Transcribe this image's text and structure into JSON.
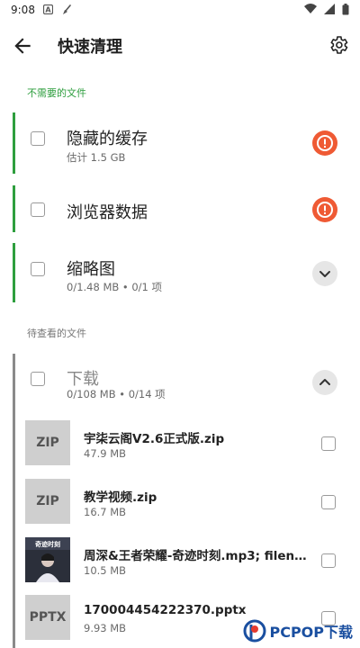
{
  "status_bar": {
    "time": "9:08",
    "left_icons": [
      "notification-a-icon",
      "broom-icon"
    ],
    "right_icons": [
      "wifi-icon",
      "signal-icon",
      "battery-icon"
    ]
  },
  "app_bar": {
    "title": "快速清理",
    "back_icon": "back-arrow-icon",
    "settings_icon": "gear-icon"
  },
  "section_unneeded": {
    "label": "不需要的文件",
    "color": "#2e9e3e"
  },
  "cards_unneeded": [
    {
      "title": "隐藏的缓存",
      "subtitle": "估计 1.5 GB",
      "action": "warning"
    },
    {
      "title": "浏览器数据",
      "subtitle": "",
      "action": "warning"
    },
    {
      "title": "缩略图",
      "subtitle": "0/1.48 MB • 0/1 项",
      "action": "expand"
    }
  ],
  "section_review": {
    "label": "待查看的文件",
    "color": "#777777"
  },
  "downloads_card": {
    "title": "下载",
    "subtitle": "0/108 MB • 0/14 项",
    "action": "collapse"
  },
  "files": [
    {
      "thumb": "ZIP",
      "name": "宇柒云阁V2.6正式版.zip",
      "size": "47.9 MB"
    },
    {
      "thumb": "ZIP",
      "name": "教学视频.zip",
      "size": "16.7 MB"
    },
    {
      "thumb": "image",
      "name": "周深&王者荣耀-奇迹时刻.mp3; filena…",
      "size": "10.5 MB"
    },
    {
      "thumb": "PPTX",
      "name": "170004454222370.pptx",
      "size": "9.93 MB"
    }
  ],
  "watermark": {
    "text": "PCPOP下载",
    "color": "#1a4fa0"
  },
  "colors": {
    "warning": "#ef5a34",
    "accent_green": "#2e9e3e"
  }
}
